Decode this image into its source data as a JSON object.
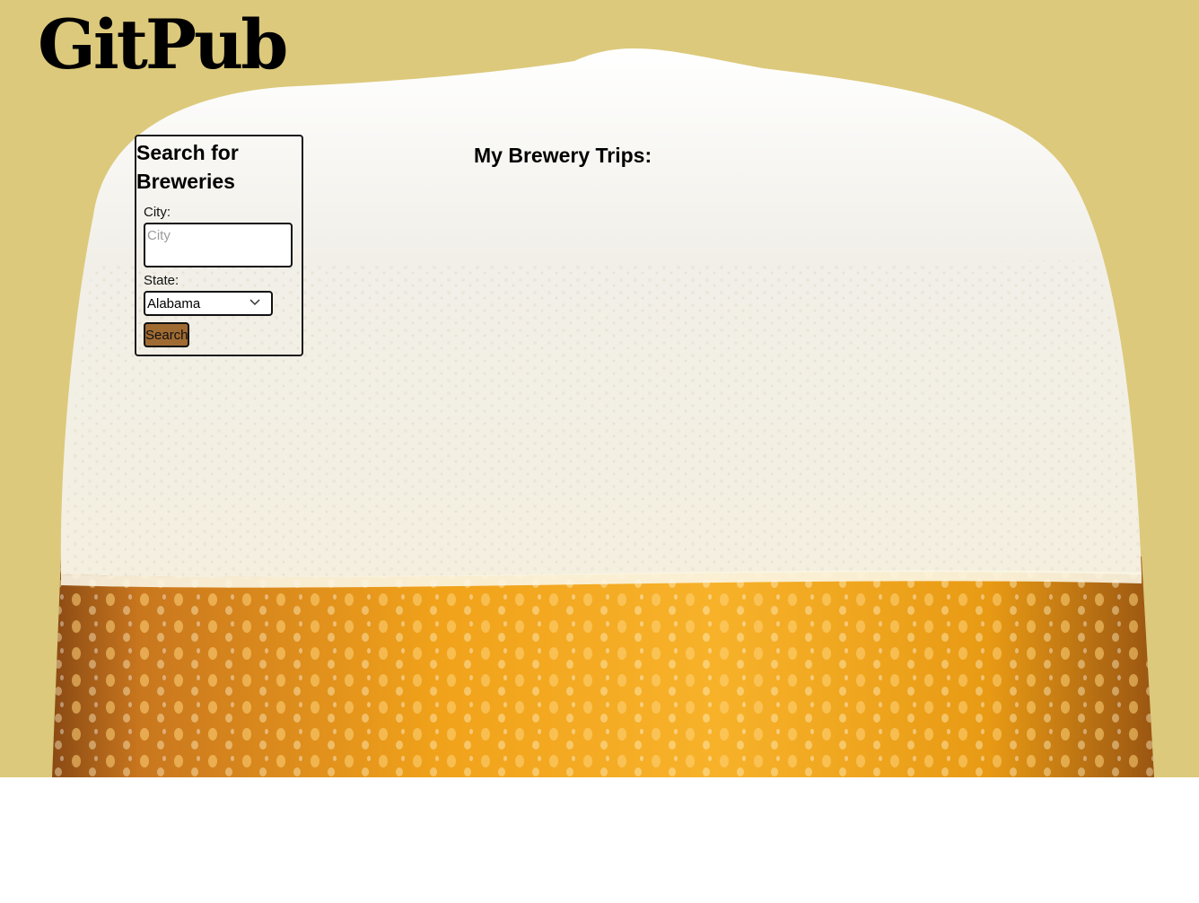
{
  "header": {
    "title": "GitPub"
  },
  "search": {
    "heading": "Search for Breweries",
    "city_label": "City:",
    "city_placeholder": "City",
    "city_value": "",
    "state_label": "State:",
    "state_selected": "Alabama",
    "button_label": "Search"
  },
  "trips": {
    "heading": "My Brewery Trips:"
  },
  "colors": {
    "page_background": "#dcc97b",
    "button_background": "#a06b33",
    "beer": "#f3a51a",
    "foam": "#f6f4ee"
  },
  "icons": {
    "select_chevron": "chevron-down-icon",
    "background_image": "beer-glass-image"
  }
}
